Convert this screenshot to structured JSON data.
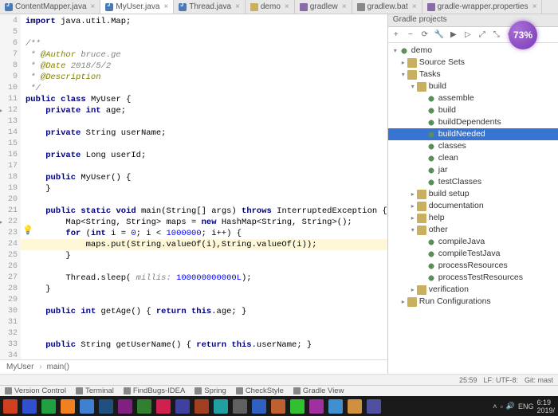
{
  "tabs": [
    {
      "name": "ContentMapper.java",
      "icon": "java"
    },
    {
      "name": "MyUser.java",
      "icon": "java",
      "active": true
    },
    {
      "name": "Thread.java",
      "icon": "java"
    },
    {
      "name": "demo",
      "icon": "fld"
    },
    {
      "name": "gradlew",
      "icon": "prop"
    },
    {
      "name": "gradlew.bat",
      "icon": "bat"
    },
    {
      "name": "gradle-wrapper.properties",
      "icon": "prop"
    }
  ],
  "gutter_start": 4,
  "gutter_end": 39,
  "run_markers": [
    12,
    22
  ],
  "bulb_line": 25,
  "code": [
    {
      "t": "import java.util.Map;",
      "cls": "kw1"
    },
    {
      "t": ""
    },
    {
      "t": "/**",
      "cls": "cm"
    },
    {
      "t": " * @Author bruce.ge",
      "cls": "cm-ann"
    },
    {
      "t": " * @Date 2018/5/2",
      "cls": "cm-ann"
    },
    {
      "t": " * @Description",
      "cls": "cm-ann"
    },
    {
      "t": " */",
      "cls": "cm"
    },
    {
      "t": "public class MyUser {",
      "cls": "kw"
    },
    {
      "t": "    private int age;",
      "cls": "kw"
    },
    {
      "t": ""
    },
    {
      "t": "    private String userName;",
      "cls": "kw"
    },
    {
      "t": ""
    },
    {
      "t": "    private Long userId;",
      "cls": "kw"
    },
    {
      "t": ""
    },
    {
      "t": "    public MyUser() {",
      "cls": "kw"
    },
    {
      "t": "    }"
    },
    {
      "t": ""
    },
    {
      "t": "    public static void main(String[] args) throws InterruptedException {",
      "cls": "kw"
    },
    {
      "t": "        Map<String, String> maps = new HashMap<String, String>();",
      "cls": ""
    },
    {
      "t": "        for (int i = 0; i < 1000000; i++) {",
      "cls": "kw"
    },
    {
      "t": "            maps.put(String.valueOf(i),String.valueOf(i));",
      "hl": true
    },
    {
      "t": "        }"
    },
    {
      "t": ""
    },
    {
      "t": "        Thread.sleep( millis: 100000000000L);",
      "cls": ""
    },
    {
      "t": "    }"
    },
    {
      "t": ""
    },
    {
      "t": "    public int getAge() { return this.age; }",
      "cls": "kw"
    },
    {
      "t": ""
    },
    {
      "t": ""
    },
    {
      "t": "    public String getUserName() { return this.userName; }",
      "cls": "kw"
    },
    {
      "t": ""
    }
  ],
  "breadcrumb": [
    "MyUser",
    "main()"
  ],
  "side_panel_title": "Gradle projects",
  "toolbar_icons": [
    "plus-icon",
    "minus-icon",
    "refresh-icon",
    "wrench-icon",
    "run-icon",
    "play-icon",
    "expand-icon",
    "collapse-icon",
    "settings-icon"
  ],
  "tree": [
    {
      "d": 0,
      "ar": "▾",
      "ic": "gear",
      "lbl": "demo"
    },
    {
      "d": 1,
      "ar": "▸",
      "ic": "fld",
      "lbl": "Source Sets"
    },
    {
      "d": 1,
      "ar": "▾",
      "ic": "fld",
      "lbl": "Tasks"
    },
    {
      "d": 2,
      "ar": "▾",
      "ic": "fld",
      "lbl": "build"
    },
    {
      "d": 3,
      "ar": "",
      "ic": "gear",
      "lbl": "assemble"
    },
    {
      "d": 3,
      "ar": "",
      "ic": "gear",
      "lbl": "build"
    },
    {
      "d": 3,
      "ar": "",
      "ic": "gear",
      "lbl": "buildDependents"
    },
    {
      "d": 3,
      "ar": "",
      "ic": "gear",
      "lbl": "buildNeeded",
      "sel": true
    },
    {
      "d": 3,
      "ar": "",
      "ic": "gear",
      "lbl": "classes"
    },
    {
      "d": 3,
      "ar": "",
      "ic": "gear",
      "lbl": "clean"
    },
    {
      "d": 3,
      "ar": "",
      "ic": "gear",
      "lbl": "jar"
    },
    {
      "d": 3,
      "ar": "",
      "ic": "gear",
      "lbl": "testClasses"
    },
    {
      "d": 2,
      "ar": "▸",
      "ic": "fld",
      "lbl": "build setup"
    },
    {
      "d": 2,
      "ar": "▸",
      "ic": "fld",
      "lbl": "documentation"
    },
    {
      "d": 2,
      "ar": "▸",
      "ic": "fld",
      "lbl": "help"
    },
    {
      "d": 2,
      "ar": "▾",
      "ic": "fld",
      "lbl": "other"
    },
    {
      "d": 3,
      "ar": "",
      "ic": "gear",
      "lbl": "compileJava"
    },
    {
      "d": 3,
      "ar": "",
      "ic": "gear",
      "lbl": "compileTestJava"
    },
    {
      "d": 3,
      "ar": "",
      "ic": "gear",
      "lbl": "processResources"
    },
    {
      "d": 3,
      "ar": "",
      "ic": "gear",
      "lbl": "processTestResources"
    },
    {
      "d": 2,
      "ar": "▸",
      "ic": "fld",
      "lbl": "verification"
    },
    {
      "d": 1,
      "ar": "▸",
      "ic": "fld",
      "lbl": "Run Configurations"
    }
  ],
  "bottom_tools": [
    "Version Control",
    "Terminal",
    "FindBugs-IDEA",
    "Spring",
    "CheckStyle",
    "Gradle View"
  ],
  "status": {
    "pos": "25:59",
    "enc": "LF: UTF-8:",
    "branch": "Git: mast"
  },
  "badge": "73%",
  "taskbar_apps": [
    "#d04020",
    "#3050d0",
    "#20a040",
    "#f08020",
    "#4080d0",
    "#205080",
    "#802080",
    "#308030",
    "#d02050",
    "#4040a0",
    "#a04020",
    "#20a0a0",
    "#606060",
    "#3060c0",
    "#c06030",
    "#30c030",
    "#a030a0",
    "#4090d0",
    "#d09040",
    "#5050a0"
  ],
  "tray": {
    "lang": "ENG",
    "date": "2019/",
    "time": "6:19"
  }
}
